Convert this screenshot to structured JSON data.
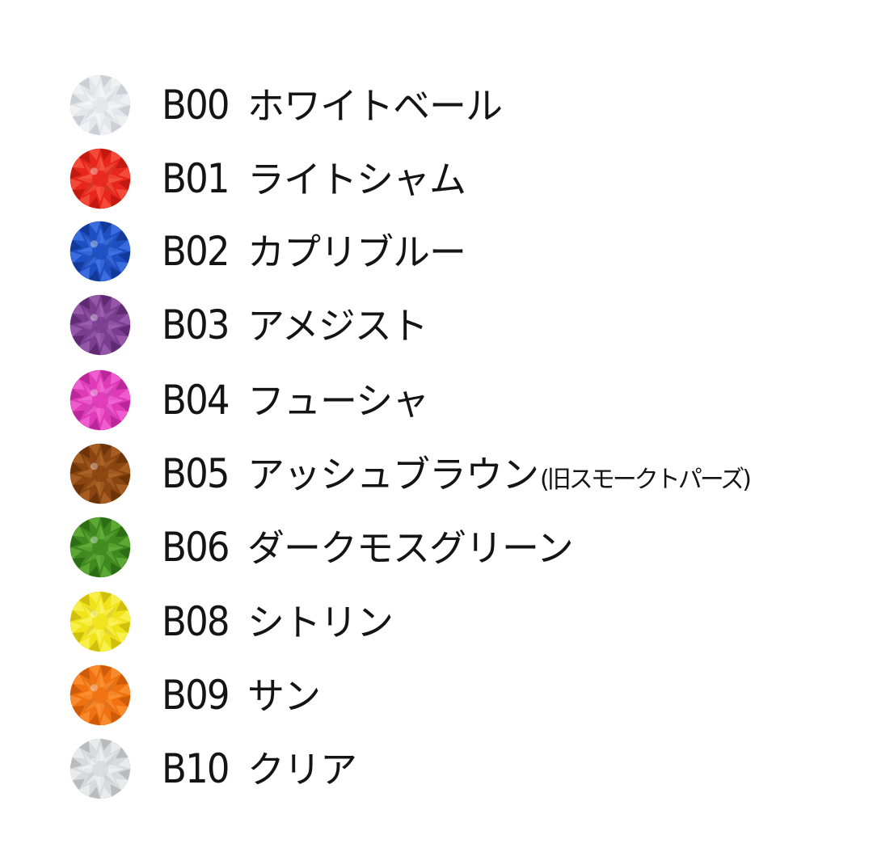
{
  "items": [
    {
      "code": "B00",
      "name": "ホワイトベール",
      "color": "#e4e6ea",
      "light": "#ffffff",
      "dark": "#b6bcc4"
    },
    {
      "code": "B01",
      "name": "ライトシャム",
      "color": "#e8261c",
      "light": "#ff7a5e",
      "dark": "#a3100c"
    },
    {
      "code": "B02",
      "name": "カプリブルー",
      "color": "#1d4fc2",
      "light": "#5f90ff",
      "dark": "#0c2a78"
    },
    {
      "code": "B03",
      "name": "アメジスト",
      "color": "#7b3d8f",
      "light": "#b57ac8",
      "dark": "#4a1d5c"
    },
    {
      "code": "B04",
      "name": "フューシャ",
      "color": "#df3ab8",
      "light": "#ff8ae6",
      "dark": "#9b1780"
    },
    {
      "code": "B05",
      "name": "アッシュブラウン",
      "note": "(旧スモークトパーズ)",
      "color": "#8a4510",
      "light": "#c77a3a",
      "dark": "#552606"
    },
    {
      "code": "B06",
      "name": "ダークモスグリーン",
      "color": "#3f8a1f",
      "light": "#7fcb4f",
      "dark": "#1f560c"
    },
    {
      "code": "B08",
      "name": "シトリン",
      "color": "#f1e31a",
      "light": "#ffff8a",
      "dark": "#b3a306"
    },
    {
      "code": "B09",
      "name": "サン",
      "color": "#f0710f",
      "light": "#ffab52",
      "dark": "#b04807"
    },
    {
      "code": "B10",
      "name": "クリア",
      "color": "#d9dadc",
      "light": "#ffffff",
      "dark": "#a0a3a8"
    }
  ]
}
